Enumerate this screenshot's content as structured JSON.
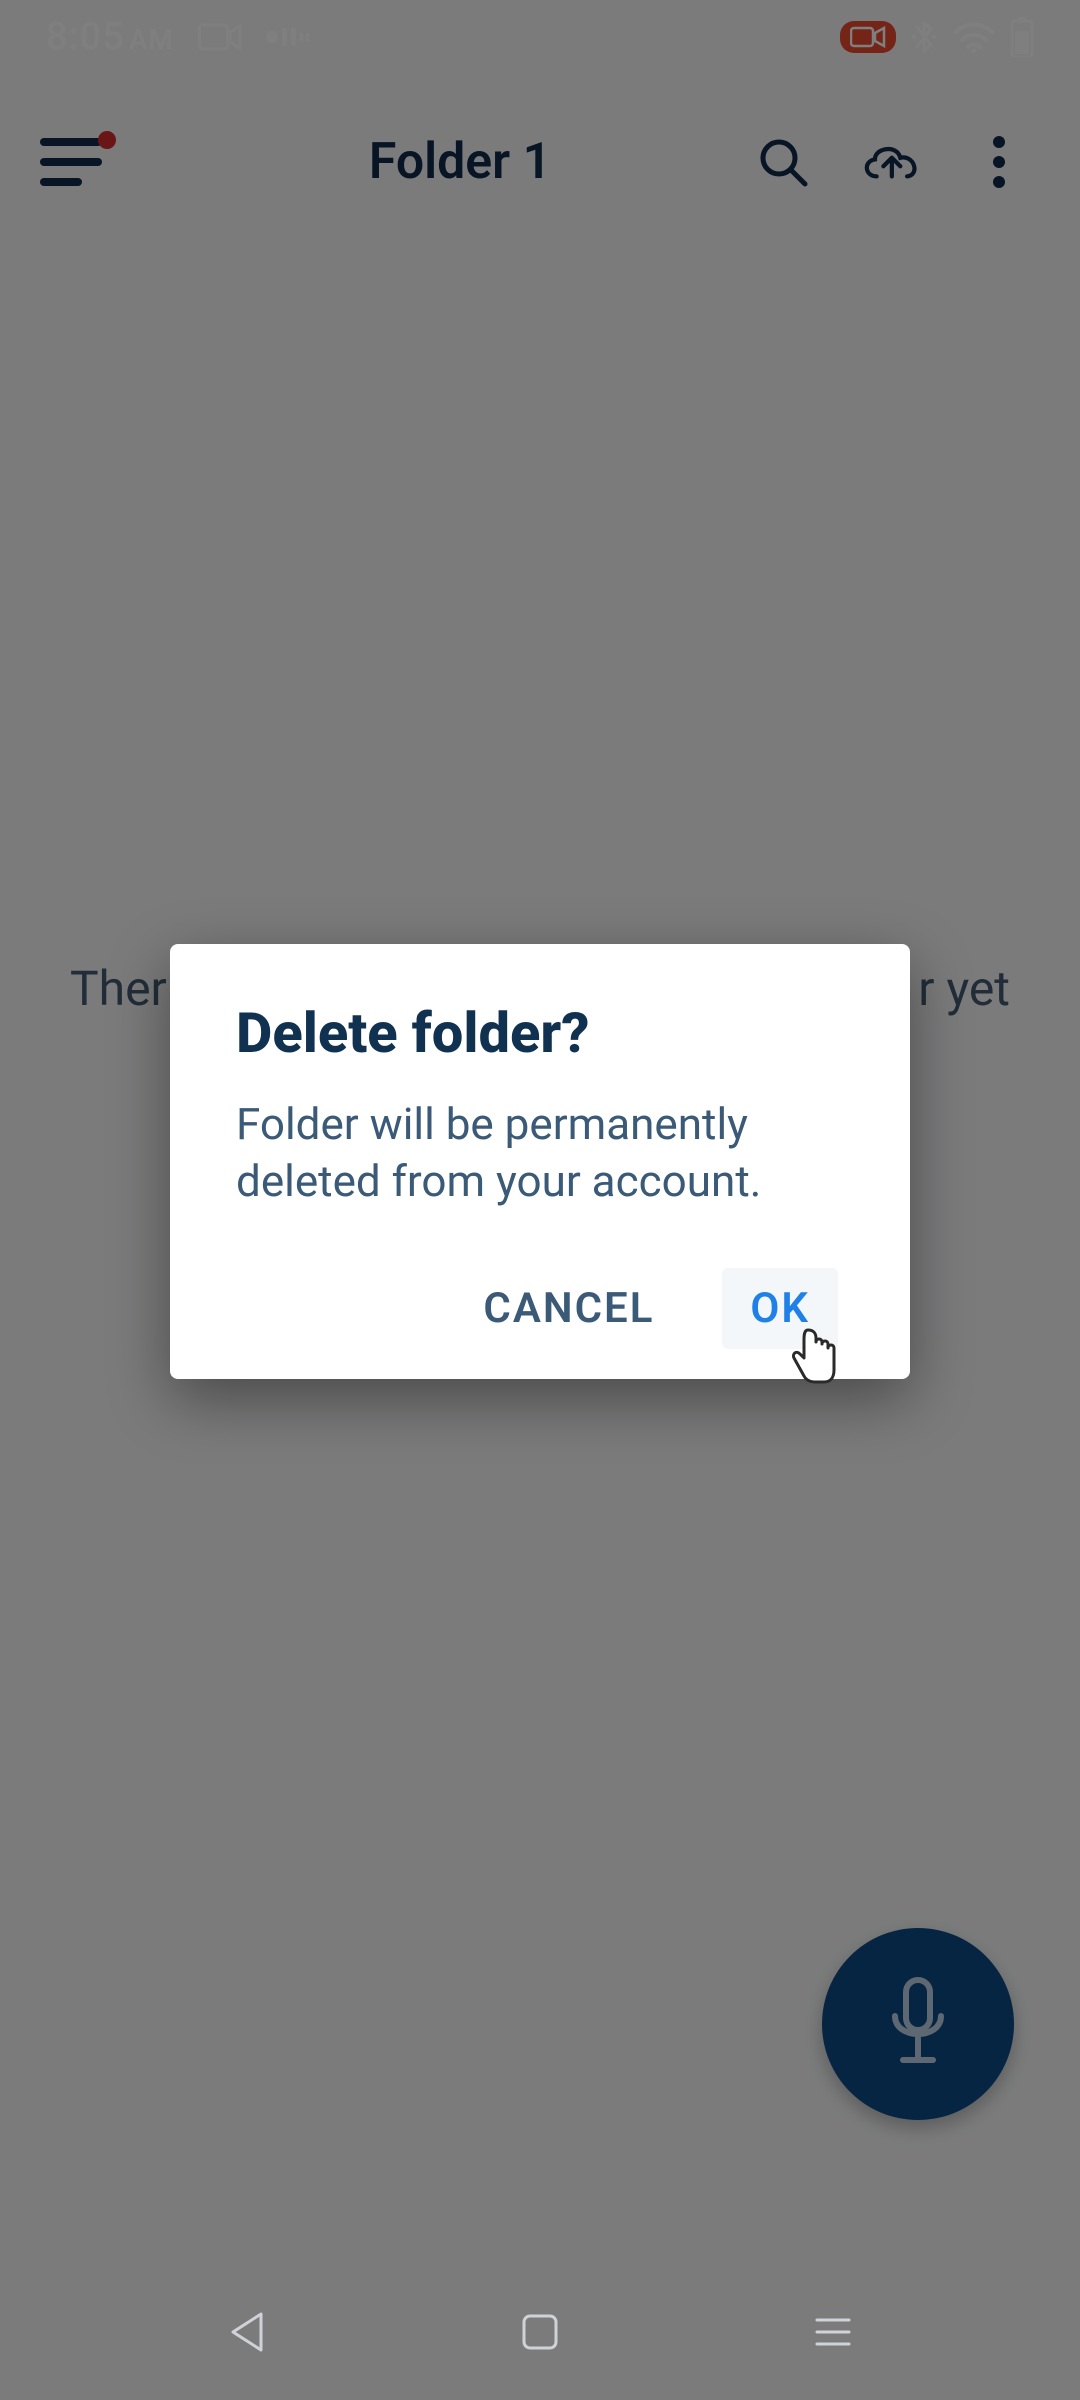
{
  "status_bar": {
    "time": "8:05",
    "meridiem": "AM",
    "rec_indicator": "rec",
    "bt": "bluetooth",
    "wifi": "wifi",
    "batt": "battery"
  },
  "app_bar": {
    "title": "Folder 1",
    "menu_badge": true
  },
  "main": {
    "empty_text_left": "Ther",
    "empty_text_right": "r yet"
  },
  "dialog": {
    "title": "Delete folder?",
    "body": "Folder will be permanently deleted from your account.",
    "cancel_label": "CANCEL",
    "ok_label": "OK"
  },
  "fab": {
    "name": "record"
  }
}
